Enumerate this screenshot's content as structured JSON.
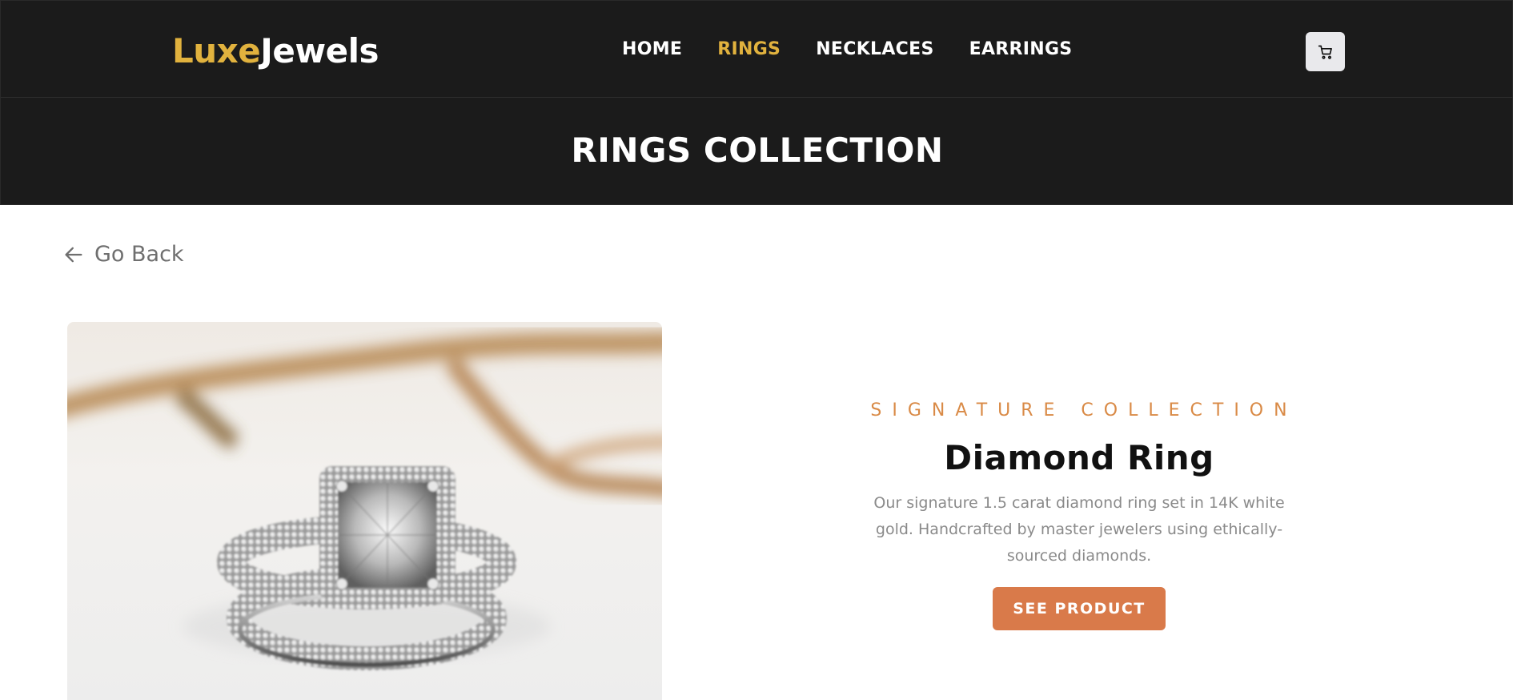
{
  "brand": {
    "part1": "Luxe",
    "part2": "Jewels"
  },
  "nav": [
    {
      "label": "HOME",
      "active": false
    },
    {
      "label": "RINGS",
      "active": true
    },
    {
      "label": "NECKLACES",
      "active": false
    },
    {
      "label": "EARRINGS",
      "active": false
    }
  ],
  "cart": {
    "icon": "cart-icon"
  },
  "hero": {
    "title": "RINGS COLLECTION"
  },
  "back": {
    "label": "Go Back",
    "icon": "arrow-left-icon"
  },
  "product": {
    "eyebrow": "SIGNATURE COLLECTION",
    "name": "Diamond Ring",
    "description": "Our signature 1.5 carat diamond ring set in 14K white gold. Handcrafted by master jewelers using ethically-sourced diamonds.",
    "cta": "SEE PRODUCT",
    "image_alt": "diamond ring photo"
  },
  "colors": {
    "dark": "#1b1b1b",
    "gold": "#e1b23e",
    "accent": "#d97a4a",
    "eyebrow": "#d98a46"
  }
}
